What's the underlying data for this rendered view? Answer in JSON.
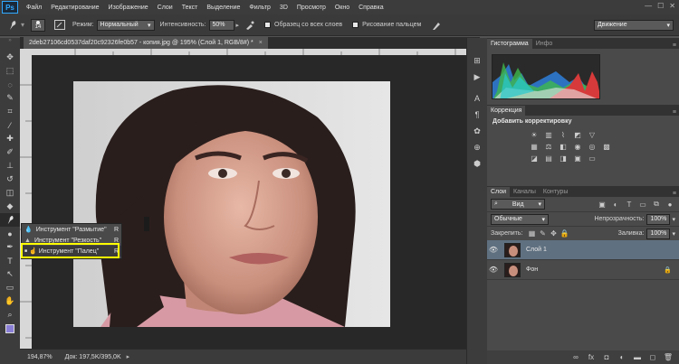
{
  "app": {
    "logo": "Ps"
  },
  "menu": [
    "Файл",
    "Редактирование",
    "Изображение",
    "Слои",
    "Текст",
    "Выделение",
    "Фильтр",
    "3D",
    "Просмотр",
    "Окно",
    "Справка"
  ],
  "window_controls": {
    "minimize": "—",
    "maximize": "☐",
    "close": "✕"
  },
  "options_bar": {
    "brush_size": "14",
    "mode_label": "Режим:",
    "mode_value": "Нормальный",
    "intensity_label": "Интенсивность:",
    "intensity_value": "50%",
    "sample_all_label": "Образец со всех слоев",
    "finger_paint_label": "Рисование пальцем",
    "workspace_value": "Движение"
  },
  "document": {
    "tab_title": "2deb27106cd0537daf20c92326fe0b57 - копия.jpg @ 195% (Слой 1, RGB/8#) *",
    "zoom": "194,87%",
    "doc_info": "Док: 197,5K/395,0K"
  },
  "flyout": {
    "items": [
      "Инструмент \"Размытие\"",
      "Инструмент \"Резкость\"",
      "Инструмент \"Палец\""
    ],
    "shortcut": "R",
    "selected_index": 2
  },
  "histogram_panel": {
    "tabs": [
      "Гистограмма",
      "Инфо"
    ]
  },
  "corrections_panel": {
    "tab": "Коррекция",
    "title": "Добавить корректировку"
  },
  "layers_panel": {
    "tabs": [
      "Слои",
      "Каналы",
      "Контуры"
    ],
    "filter_value": "Вид",
    "blend_mode": "Обычные",
    "opacity_label": "Непрозрачность:",
    "opacity_value": "100%",
    "lock_label": "Закрепить:",
    "fill_label": "Заливка:",
    "fill_value": "100%",
    "layers": [
      {
        "name": "Слой 1",
        "selected": true,
        "locked": false
      },
      {
        "name": "Фон",
        "selected": false,
        "locked": true
      }
    ],
    "footer_icons": [
      "link-icon",
      "fx-icon",
      "mask-icon",
      "adjustment-icon",
      "folder-icon",
      "new-layer-icon",
      "trash-icon"
    ]
  },
  "colors": {
    "accent_highlight": "#ffff00",
    "menubar_bg": "#3c3c3c",
    "panel_bg": "#4a4a4a",
    "selected_layer": "#5f7080"
  }
}
